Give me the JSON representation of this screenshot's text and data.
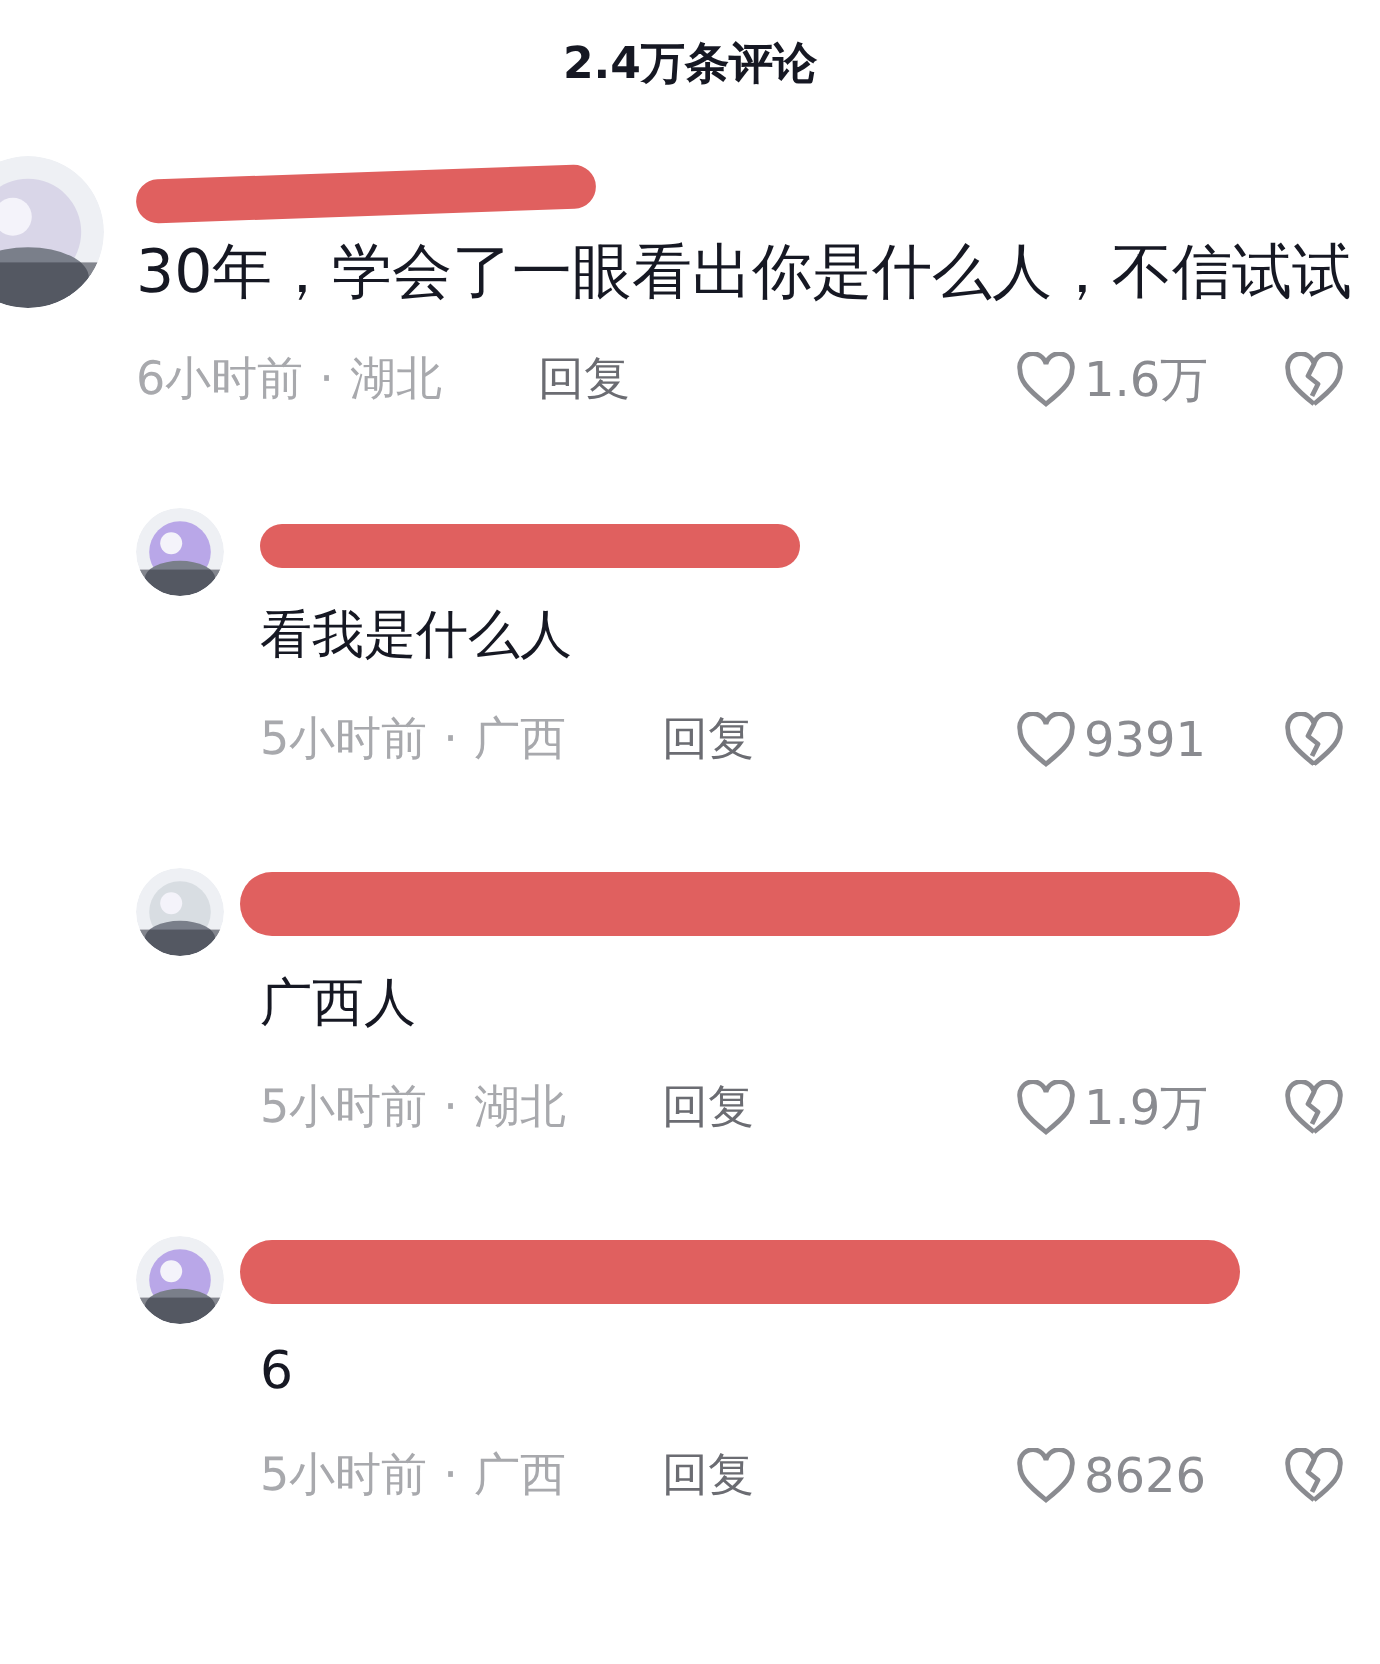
{
  "header": {
    "title": "2.4万条评论"
  },
  "comments": [
    {
      "text": "30年，学会了一眼看出你是什么人，不信试试",
      "time": "6小时前",
      "separator": "·",
      "location": "湖北",
      "reply": "回复",
      "likes": "1.6万",
      "replies": [
        {
          "text": "看我是什么人",
          "time": "5小时前",
          "separator": "·",
          "location": "广西",
          "reply": "回复",
          "likes": "9391"
        },
        {
          "text": "广西人",
          "time": "5小时前",
          "separator": "·",
          "location": "湖北",
          "reply": "回复",
          "likes": "1.9万"
        },
        {
          "text": "6",
          "time": "5小时前",
          "separator": "·",
          "location": "广西",
          "reply": "回复",
          "likes": "8626"
        }
      ]
    }
  ]
}
